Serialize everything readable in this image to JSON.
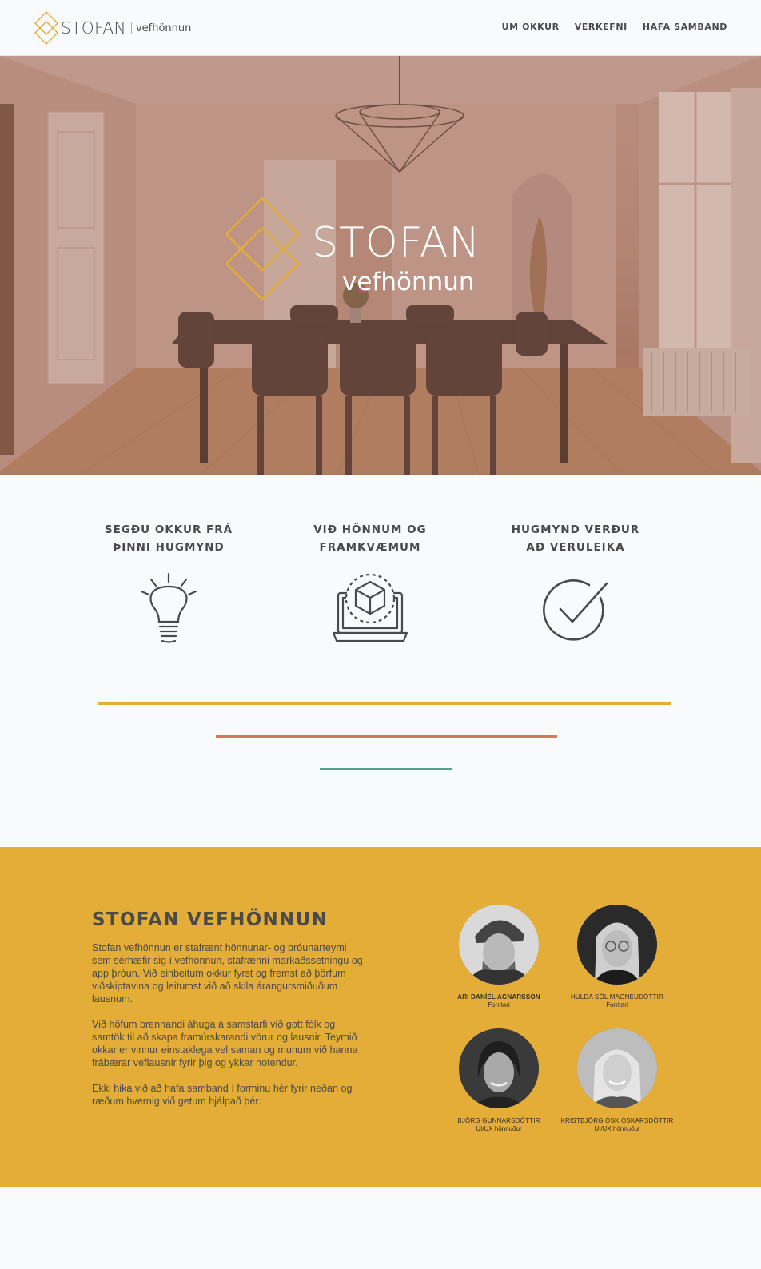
{
  "brand": {
    "name": "STOFAN",
    "sub": "vefhönnun",
    "accent": "#e3ad38"
  },
  "nav": {
    "items": [
      "UM OKKUR",
      "VERKEFNI",
      "HAFA SAMBAND"
    ]
  },
  "hero": {
    "title": "STOFAN",
    "subtitle": "vefhönnun"
  },
  "steps": [
    {
      "line1": "SEGÐU OKKUR FRÁ",
      "line2": "ÞINNI HUGMYND",
      "icon": "lightbulb-icon"
    },
    {
      "line1": "VIÐ HÖNNUM OG",
      "line2": "FRAMKVÆMUM",
      "icon": "laptop-cube-icon"
    },
    {
      "line1": "HUGMYND VERÐUR",
      "line2": "AÐ VERULEIKA",
      "icon": "checkmark-circle-icon"
    }
  ],
  "bars": {
    "colors": [
      "#e3ad38",
      "#d47a5a",
      "#4fa58a"
    ]
  },
  "about": {
    "title": "STOFAN VEFHÖNNUN",
    "paragraphs": [
      "Stofan vefhönnun er stafrænt hönnunar- og þróunarteymi sem sérhæfir sig í vefhönnun, stafrænni markaðssetningu og app þróun. Við einbeitum okkur fyrst og fremst að þörfum viðskiptavina og leitumst við að skila árangursmiðuðum lausnum.",
      "Við höfum brennandi áhuga á samstarfi við gott fólk og samtök til að skapa framúrskarandi vörur og lausnir. Teymið okkar er vinnur einstaklega vel saman og munum við hanna frábærar veflausnir fyrir þig og ykkar notendur.",
      "Ekki hika við að hafa samband í forminu hér fyrir neðan og ræðum hvernig við getum hjálpað þér."
    ]
  },
  "team": [
    {
      "name": "ARI DANÍEL AGNARSSON",
      "role": "Forritari"
    },
    {
      "name": "HULDA SÓL MAGNEUDÓTTIR",
      "role": "Forritari"
    },
    {
      "name": "BJÖRG GUNNARSDÓTTIR",
      "role": "UI/UX hönnuður"
    },
    {
      "name": "KRISTBJÖRG  ÓSK ÓSKARSDÓTTIR",
      "role": "UI/UX hönnuður"
    }
  ]
}
